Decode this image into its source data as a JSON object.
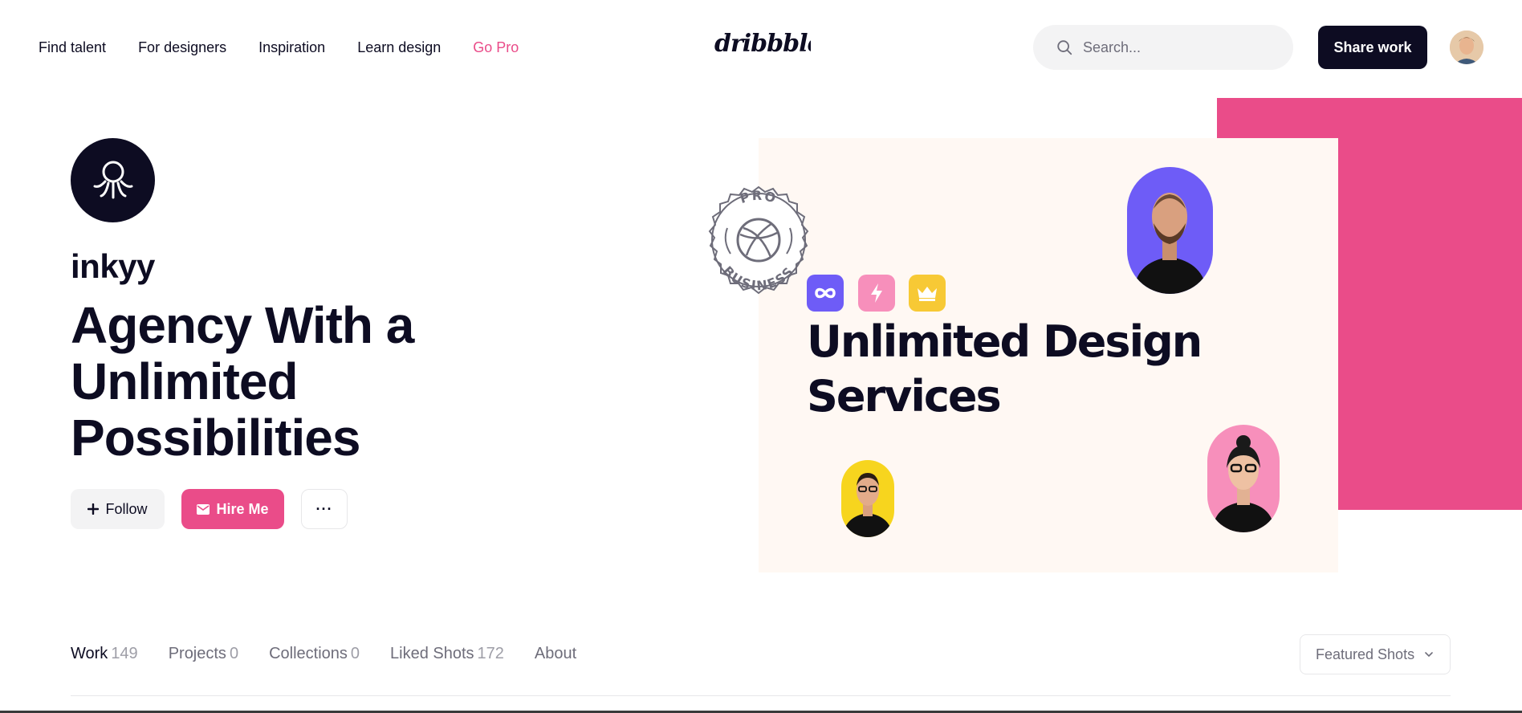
{
  "nav": {
    "links": [
      "Find talent",
      "For designers",
      "Inspiration",
      "Learn design",
      "Go Pro"
    ],
    "logo_text": "dribbble",
    "search_placeholder": "Search...",
    "share_label": "Share work"
  },
  "profile": {
    "username": "inkyy",
    "headline": "Agency With a Unlimited Possibilities",
    "follow_label": "Follow",
    "hire_label": "Hire Me",
    "more_label": "···"
  },
  "cover": {
    "title_line1": "Unlimited Design",
    "title_line2": "Services",
    "seal_top": "PRO",
    "seal_bottom": "BUSINESS"
  },
  "tabs": [
    {
      "label": "Work",
      "count": "149"
    },
    {
      "label": "Projects",
      "count": "0"
    },
    {
      "label": "Collections",
      "count": "0"
    },
    {
      "label": "Liked Shots",
      "count": "172"
    },
    {
      "label": "About",
      "count": ""
    }
  ],
  "sort": {
    "selected": "Featured Shots"
  },
  "colors": {
    "brand_pink": "#ea4c89",
    "dark": "#0d0c22",
    "violet": "#6e5cf7",
    "yellow": "#f7c935",
    "pink_light": "#f78fbb"
  }
}
